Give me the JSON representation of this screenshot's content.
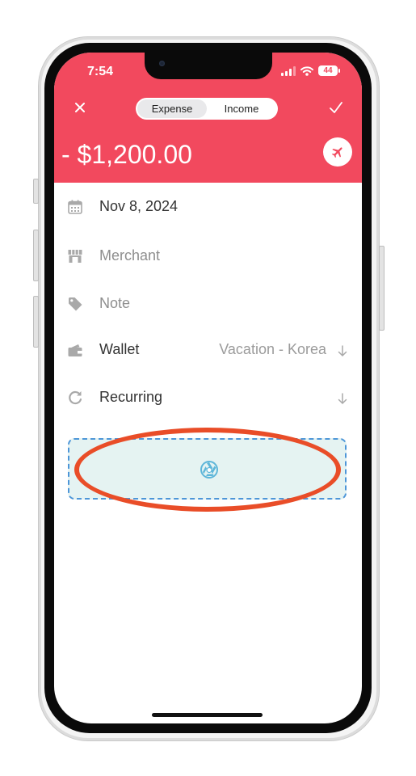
{
  "status_bar": {
    "time": "7:54",
    "battery": "44"
  },
  "header": {
    "segments": [
      {
        "label": "Expense",
        "active": true
      },
      {
        "label": "Income",
        "active": false
      }
    ],
    "amount": "- $1,200.00",
    "category_icon": "airplane-icon",
    "accent_color": "#f2495e"
  },
  "fields": {
    "date": {
      "label": "Nov 8, 2024",
      "icon": "calendar-icon"
    },
    "merchant": {
      "placeholder": "Merchant",
      "icon": "store-icon"
    },
    "note": {
      "placeholder": "Note",
      "icon": "tag-icon"
    },
    "wallet": {
      "label": "Wallet",
      "value": "Vacation - Korea",
      "icon": "wallet-icon"
    },
    "recurring": {
      "label": "Recurring",
      "icon": "repeat-icon"
    }
  },
  "attachment": {
    "icon": "aperture-icon"
  },
  "annotation": {
    "color": "#e94d28"
  }
}
